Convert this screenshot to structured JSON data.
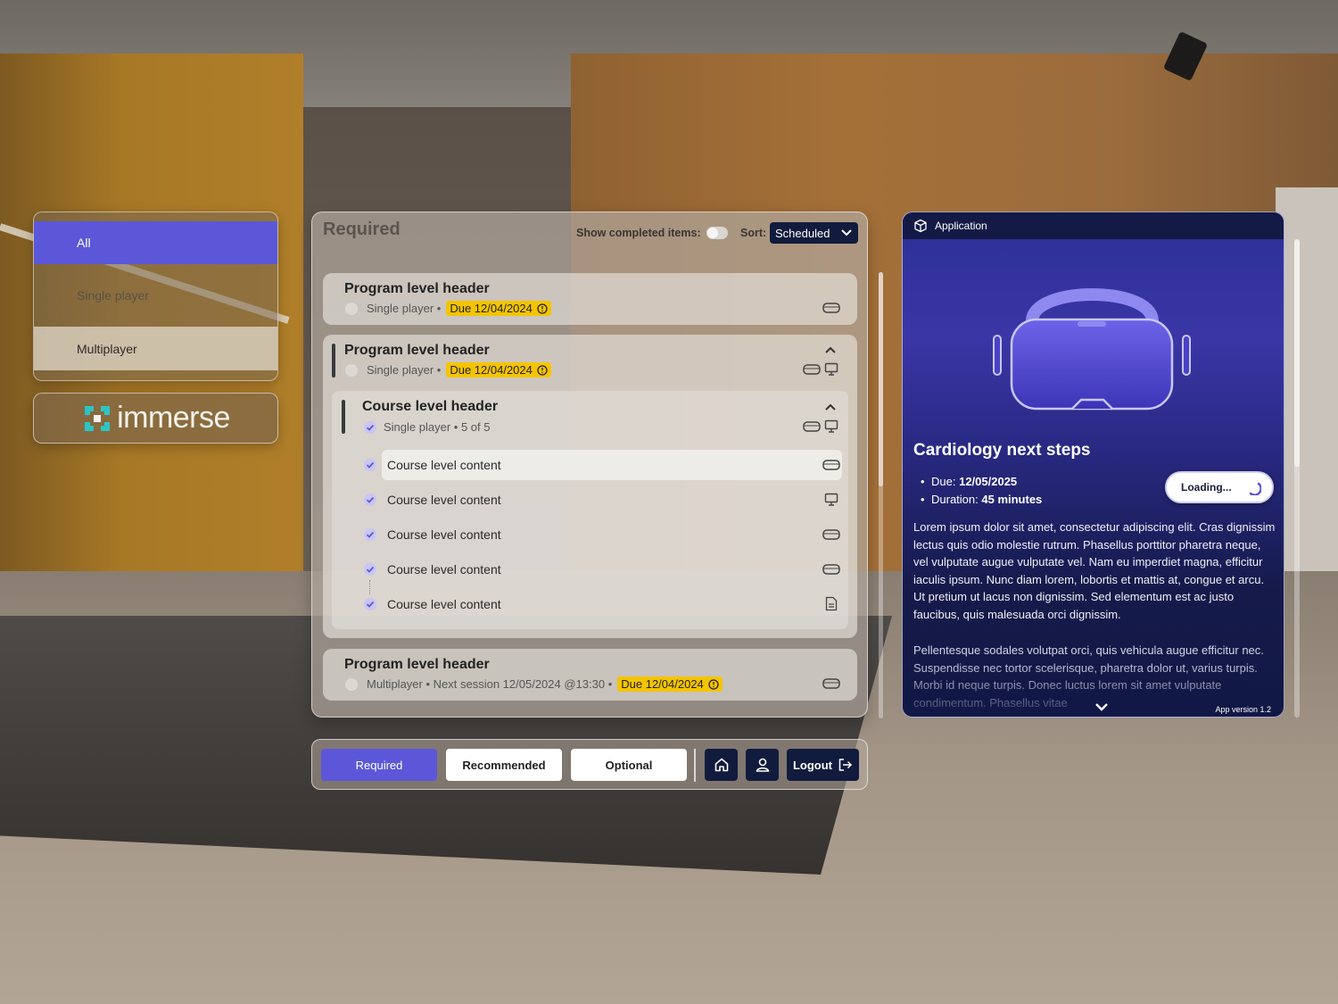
{
  "filters": {
    "all": "All",
    "single": "Single player",
    "multi": "Multiplayer"
  },
  "logo": {
    "text": "immerse",
    "accent_color": "#2cc5c5"
  },
  "main": {
    "title": "Required",
    "show_completed_label": "Show completed items:",
    "sort_label": "Sort:",
    "sort_value": "Scheduled",
    "cards": [
      {
        "title": "Program level header",
        "mode": "Single player",
        "sep": "•",
        "due": "Due 12/04/2024"
      },
      {
        "title": "Program level header",
        "mode": "Single player",
        "sep": "•",
        "due": "Due 12/04/2024",
        "course": {
          "title": "Course level header",
          "mode": "Single player",
          "progress": "• 5 of 5",
          "items": [
            {
              "label": "Course level content",
              "icon": "vr-headset-icon"
            },
            {
              "label": "Course level content",
              "icon": "desktop-icon"
            },
            {
              "label": "Course level content",
              "icon": "vr-headset-icon"
            },
            {
              "label": "Course level content",
              "icon": "vr-headset-icon"
            },
            {
              "label": "Course level content",
              "icon": "document-icon"
            }
          ]
        }
      },
      {
        "title": "Program level header",
        "mode": "Multiplayer",
        "session": "• Next session 12/05/2024 @13:30 •",
        "due": "Due 12/04/2024"
      }
    ]
  },
  "tabs": {
    "required": "Required",
    "recommended": "Recommended",
    "optional": "Optional",
    "logout": "Logout"
  },
  "app": {
    "header": "Application",
    "title": "Cardiology next steps",
    "due_label": "Due:",
    "due_value": "12/05/2025",
    "duration_label": "Duration:",
    "duration_value": "45 minutes",
    "loading": "Loading...",
    "para1": "Lorem ipsum dolor sit amet, consectetur adipiscing elit. Cras dignissim lectus quis odio molestie rutrum. Phasellus porttitor pharetra neque, vel vulputate augue vulputate vel. Nam eu imperdiet magna, efficitur iaculis ipsum. Nunc diam lorem, lobortis et mattis at, congue et arcu. Ut pretium ut lacus non dignissim. Sed elementum est ac justo faucibus, quis malesuada orci dignissim.",
    "para2": "Pellentesque sodales volutpat orci, quis vehicula augue efficitur nec. Suspendisse nec tortor scelerisque, pharetra dolor ut, varius turpis. Morbi id neque turpis. Donec luctus lorem sit amet vulputate condimentum. Phasellus vitae",
    "version": "App version 1.2"
  },
  "colors": {
    "accent": "#5b57d8",
    "navy": "#111b3d",
    "due_yellow": "#f5c400",
    "check_purple": "#5b57d8"
  }
}
